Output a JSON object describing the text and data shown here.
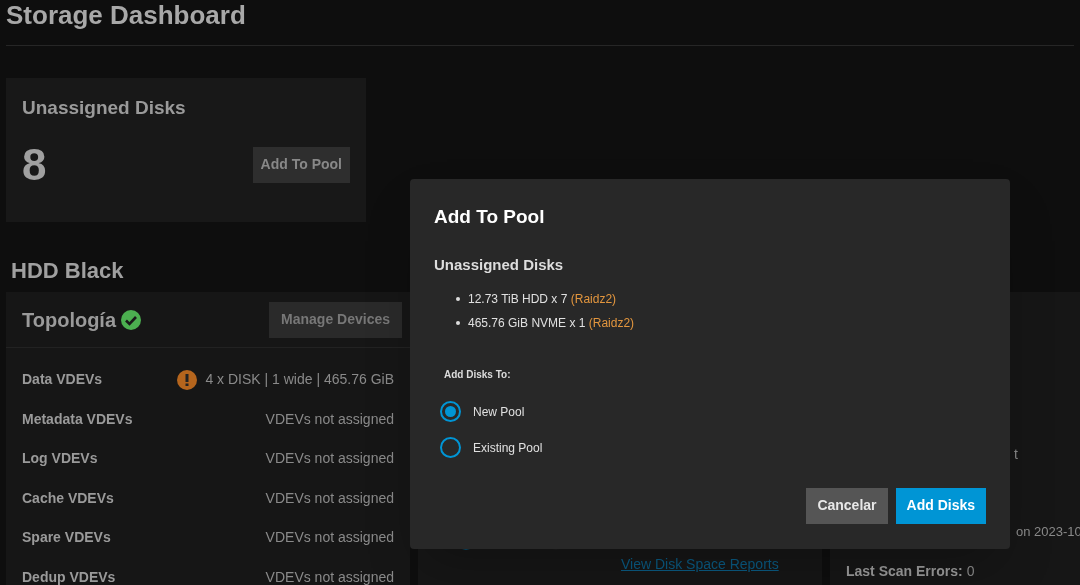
{
  "page": {
    "title": "Storage Dashboard"
  },
  "unassigned_card": {
    "title": "Unassigned Disks",
    "count": "8",
    "button": "Add To Pool"
  },
  "pool": {
    "name": "HDD Black",
    "topology": {
      "title": "Topología",
      "healthy": true,
      "button": "Manage Devices",
      "rows": [
        {
          "label": "Data VDEVs",
          "value": "4 x DISK | 1 wide | 465.76 GiB",
          "warning": true
        },
        {
          "label": "Metadata VDEVs",
          "value": "VDEVs not assigned",
          "warning": false
        },
        {
          "label": "Log VDEVs",
          "value": "VDEVs not assigned",
          "warning": false
        },
        {
          "label": "Cache VDEVs",
          "value": "VDEVs not assigned",
          "warning": false
        },
        {
          "label": "Spare VDEVs",
          "value": "VDEVs not assigned",
          "warning": false
        },
        {
          "label": "Dedup VDEVs",
          "value": "VDEVs not assigned",
          "warning": false
        }
      ]
    }
  },
  "usage_card": {
    "link": "View Disk Space Reports"
  },
  "scan_card": {
    "line_1": "t",
    "line_2": "on 2023-10",
    "errors_label": "Last Scan Errors:",
    "errors_value": "0"
  },
  "dialog": {
    "title": "Add To Pool",
    "section": "Unassigned Disks",
    "disks": [
      {
        "text": "12.73 TiB HDD x 7",
        "layout": "(Raidz2)"
      },
      {
        "text": "465.76 GiB NVME x 1",
        "layout": "(Raidz2)"
      }
    ],
    "target_label": "Add Disks To:",
    "options": [
      {
        "label": "New Pool",
        "selected": true
      },
      {
        "label": "Existing Pool",
        "selected": false
      }
    ],
    "buttons": [
      {
        "label": "Cancelar",
        "kind": "secondary"
      },
      {
        "label": "Add Disks",
        "kind": "primary"
      }
    ]
  }
}
